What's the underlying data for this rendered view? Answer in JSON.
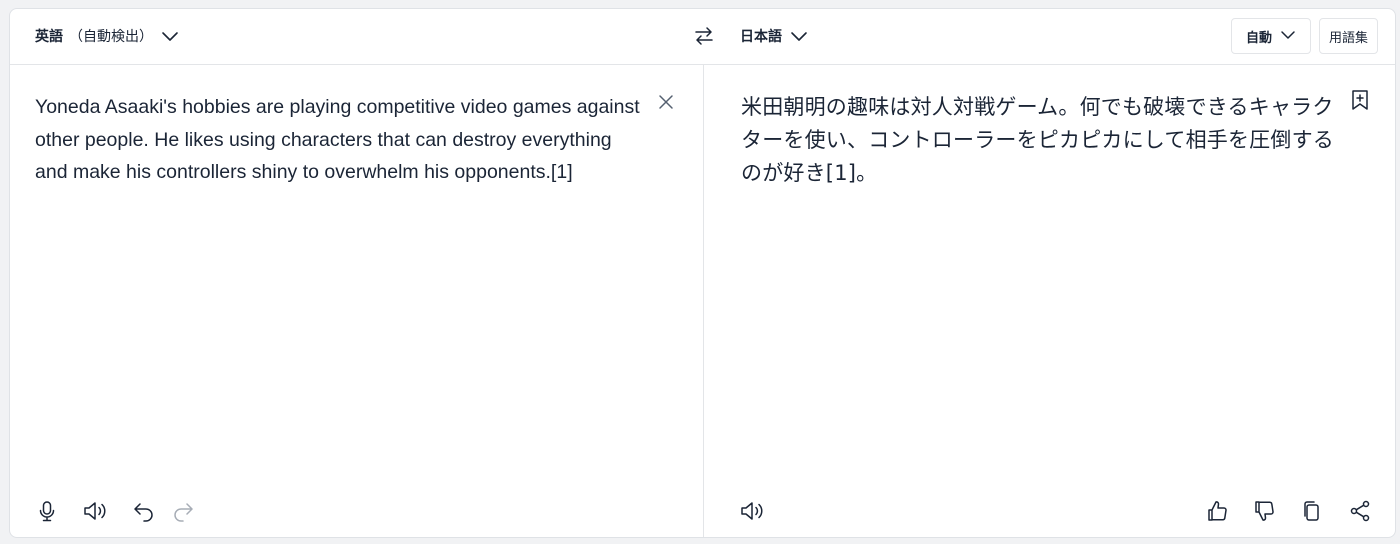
{
  "source_lang": {
    "name": "英語",
    "detect": "（自動検出）"
  },
  "target_lang": {
    "name": "日本語"
  },
  "toolbar": {
    "formality": "自動",
    "glossary": "用語集"
  },
  "source_text": "Yoneda Asaaki's hobbies are playing competitive video games against other people. He likes using characters that can destroy everything and make his controllers shiny to overwhelm his opponents.[1]",
  "target_text": "米田朝明の趣味は対人対戦ゲーム。何でも破壊できるキャラクターを使い、コントローラーをピカピカにして相手を圧倒するのが好き[1]。",
  "icons": {
    "source": [
      "microphone-icon",
      "speaker-icon",
      "undo-icon",
      "redo-icon",
      "clear-icon"
    ],
    "target": [
      "speaker-icon",
      "thumbs-up-icon",
      "thumbs-down-icon",
      "copy-icon",
      "share-icon",
      "add-note-icon"
    ]
  },
  "colors": {
    "text": "#1b2536",
    "border": "#e3e5e8",
    "icon": "#1b2536",
    "disabled_icon": "#a7adb6"
  }
}
